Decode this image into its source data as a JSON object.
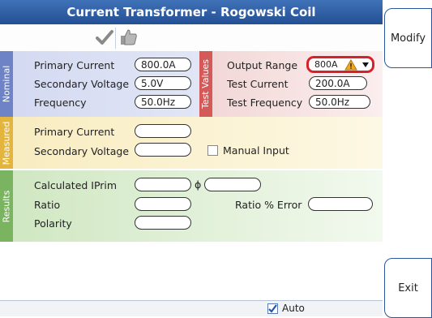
{
  "title": "Current Transformer - Rogowski Coil",
  "toolbar": {
    "check_icon": "check-icon",
    "thumbs_up_icon": "thumbs-up-icon"
  },
  "buttons": {
    "modify": "Modify",
    "exit": "Exit"
  },
  "nominal": {
    "tab_label": "Nominal",
    "primary_current_label": "Primary Current",
    "primary_current_value": "800.0A",
    "secondary_voltage_label": "Secondary Voltage",
    "secondary_voltage_value": "5.0V",
    "frequency_label": "Frequency",
    "frequency_value": "50.0Hz"
  },
  "test_values": {
    "tab_label": "Test Values",
    "output_range_label": "Output Range",
    "output_range_value": "800A",
    "test_current_label": "Test Current",
    "test_current_value": "200.0A",
    "test_frequency_label": "Test Frequency",
    "test_frequency_value": "50.0Hz"
  },
  "measured": {
    "tab_label": "Measured",
    "primary_current_label": "Primary Current",
    "primary_current_value": "",
    "secondary_voltage_label": "Secondary Voltage",
    "secondary_voltage_value": "",
    "manual_input_label": "Manual Input",
    "manual_input_checked": false
  },
  "results": {
    "tab_label": "Results",
    "calculated_iprim_label": "Calculated IPrim",
    "calculated_iprim_value": "",
    "phi_symbol": "ϕ",
    "phi_value": "",
    "ratio_label": "Ratio",
    "ratio_value": "",
    "ratio_error_label": "Ratio % Error",
    "ratio_error_value": "",
    "polarity_label": "Polarity",
    "polarity_value": ""
  },
  "status": {
    "auto_label": "Auto",
    "auto_checked": true
  },
  "colors": {
    "title_blue": "#2f5fa6",
    "nominal": "#6e82c6",
    "test_values": "#d45a5a",
    "measured": "#e3b53f",
    "results": "#7bb460",
    "highlight": "#d8202a"
  }
}
